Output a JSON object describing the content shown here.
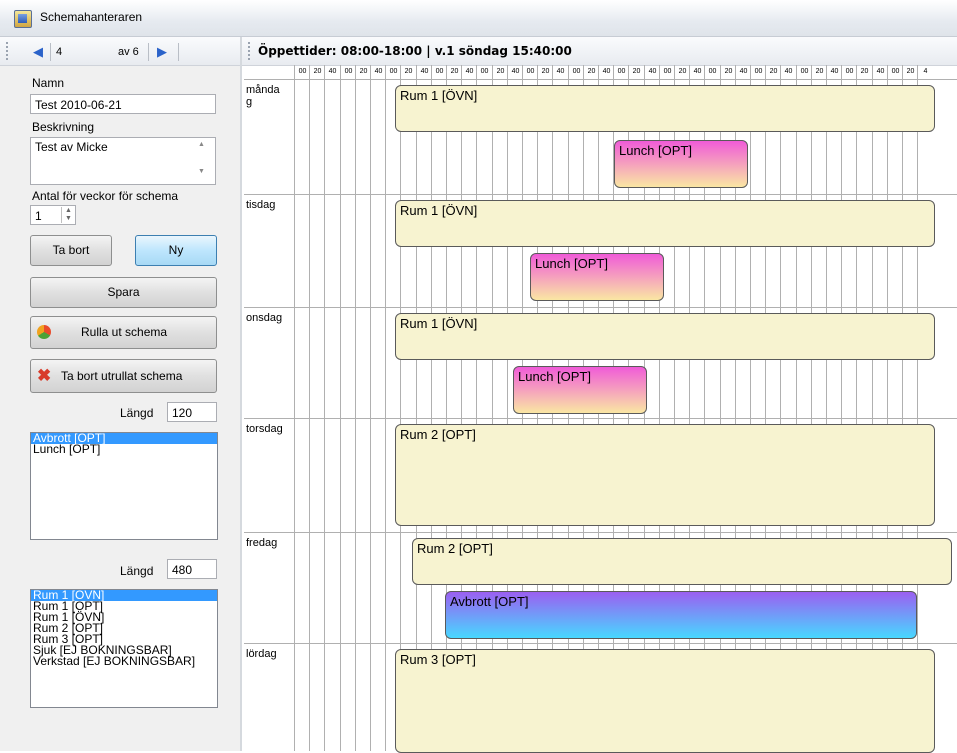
{
  "window": {
    "title": "Schemahanteraren"
  },
  "nav": {
    "position": "4",
    "of": "av 6"
  },
  "form": {
    "name_label": "Namn",
    "name_value": "Test 2010-06-21",
    "desc_label": "Beskrivning",
    "desc_value": "Test av Micke",
    "weeks_label": "Antal för veckor för schema",
    "weeks_value": "1"
  },
  "buttons": {
    "delete": "Ta bort",
    "new": "Ny",
    "save": "Spara",
    "rollout": "Rulla ut schema",
    "delete_rollout": "Ta bort utrullat schema"
  },
  "list1": {
    "length_label": "Längd",
    "length_value": "120",
    "items": [
      "Avbrott [OPT]",
      "Lunch [OPT]"
    ],
    "selected": 0
  },
  "list2": {
    "length_label": "Längd",
    "length_value": "480",
    "items": [
      "Rum 1  [ÖVN]",
      "Rum 1 [OPT]",
      "Rum 1 [ÖVN]",
      "Rum 2 [OPT]",
      "Rum 3 [OPT]",
      "Sjuk [EJ BOKNINGSBAR]",
      "Verkstad [EJ BOKNINGSBAR]"
    ],
    "selected": 0
  },
  "schedule": {
    "header": "Öppettider: 08:00-18:00  |  v.1 söndag 15:40:00",
    "ticks": [
      "00",
      "20",
      "40",
      "00",
      "20",
      "40",
      "00",
      "20",
      "40",
      "00",
      "20",
      "40",
      "00",
      "20",
      "40",
      "00",
      "20",
      "40",
      "00",
      "20",
      "40",
      "00",
      "20",
      "40",
      "00",
      "20",
      "40",
      "00",
      "20",
      "40",
      "00",
      "20",
      "40",
      "00",
      "20",
      "40",
      "00",
      "20",
      "40",
      "00",
      "20",
      "4"
    ],
    "days": [
      {
        "label": "månda\ng",
        "blocks": [
          {
            "text": "Rum 1  [ÖVN]",
            "color": "yellow"
          },
          {
            "text": "Lunch [OPT]",
            "color": "pink"
          }
        ]
      },
      {
        "label": "tisdag",
        "blocks": [
          {
            "text": "Rum 1  [ÖVN]",
            "color": "yellow"
          },
          {
            "text": "Lunch [OPT]",
            "color": "pink"
          }
        ]
      },
      {
        "label": "onsdag",
        "blocks": [
          {
            "text": "Rum 1  [ÖVN]",
            "color": "yellow"
          },
          {
            "text": "Lunch [OPT]",
            "color": "pink"
          }
        ]
      },
      {
        "label": "torsdag",
        "blocks": [
          {
            "text": "Rum 2 [OPT]",
            "color": "yellow"
          }
        ]
      },
      {
        "label": "fredag",
        "blocks": [
          {
            "text": "Rum 2 [OPT]",
            "color": "yellow"
          },
          {
            "text": "Avbrott [OPT]",
            "color": "blue"
          }
        ]
      },
      {
        "label": "lördag",
        "blocks": [
          {
            "text": "Rum 3 [OPT]",
            "color": "yellow"
          }
        ]
      }
    ]
  }
}
